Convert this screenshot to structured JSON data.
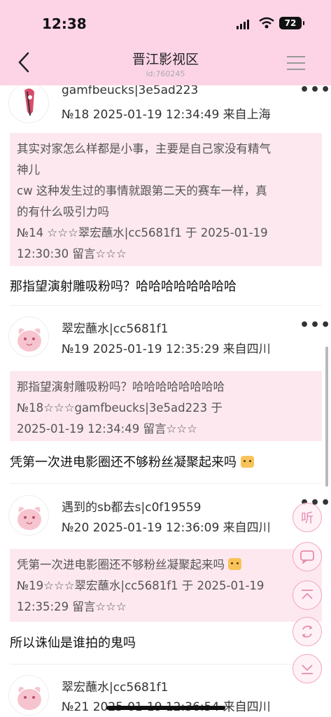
{
  "status": {
    "time": "12:38",
    "battery": "72"
  },
  "nav": {
    "title": "晋江影视区",
    "sub": "id:760245"
  },
  "posts": [
    {
      "user": "gamfbeucks|3e5ad223",
      "meta": "№18  2025-01-19 12:34:49 来自上海",
      "quote": [
        "其实对家怎么样都是小事，主要是自己家没有精气",
        "神儿",
        "cw 这种发生过的事情就跟第二天的赛车一样，真",
        "的有什么吸引力吗",
        "№14 ☆☆☆翠宏蘸水|cc5681f1 于 2025-01-19",
        "12:30:30 留言☆☆☆"
      ],
      "reply": "那指望演射雕吸粉吗？哈哈哈哈哈哈哈哈"
    },
    {
      "user": "翠宏蘸水|cc5681f1",
      "meta": "№19  2025-01-19 12:35:29 来自四川",
      "quote": [
        "那指望演射雕吸粉吗？哈哈哈哈哈哈哈哈",
        "№18☆☆☆gamfbeucks|3e5ad223 于",
        " 2025-01-19 12:34:49 留言☆☆☆"
      ],
      "reply": "凭第一次进电影圈还不够粉丝凝聚起来吗"
    },
    {
      "user": "遇到的sb都去s|c0f19559",
      "meta": "№20  2025-01-19 12:36:09 来自四川",
      "quote": [
        "凭第一次进电影圈还不够粉丝凝聚起来吗",
        "№19☆☆☆翠宏蘸水|cc5681f1 于 2025-01-19",
        "12:35:29 留言☆☆☆"
      ],
      "reply": "所以诛仙是谁拍的鬼吗"
    },
    {
      "user": "翠宏蘸水|cc5681f1",
      "meta": "№21  2025-01-19 12:36:54 来自四川"
    }
  ],
  "float": {
    "listen": "听"
  },
  "colors": {
    "header": "#fcd4e6",
    "quote_bg": "#fde8f0",
    "accent": "#e58bb0"
  }
}
